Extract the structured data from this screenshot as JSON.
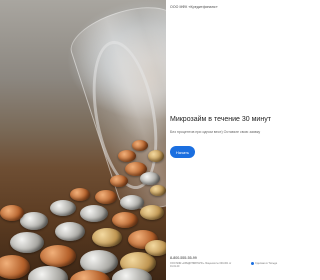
{
  "header": {
    "brand": "ООО МФК «Кредитфинанс»"
  },
  "hero": {
    "title": "Микрозайм в течение 30 минут",
    "subtitle": "Без процентов при одном весе) Оставьте свою заявку",
    "button_label": "Начать"
  },
  "footer": {
    "phone": "8-800-555-55-99",
    "legal": "ООО МФК «КРЕДИТФИНАНС» Лицензия № 000-001 от 01.01.20",
    "link": "Сделано в Тильде"
  },
  "colors": {
    "accent": "#1b6fe0",
    "text": "#222222",
    "muted": "#666666"
  }
}
